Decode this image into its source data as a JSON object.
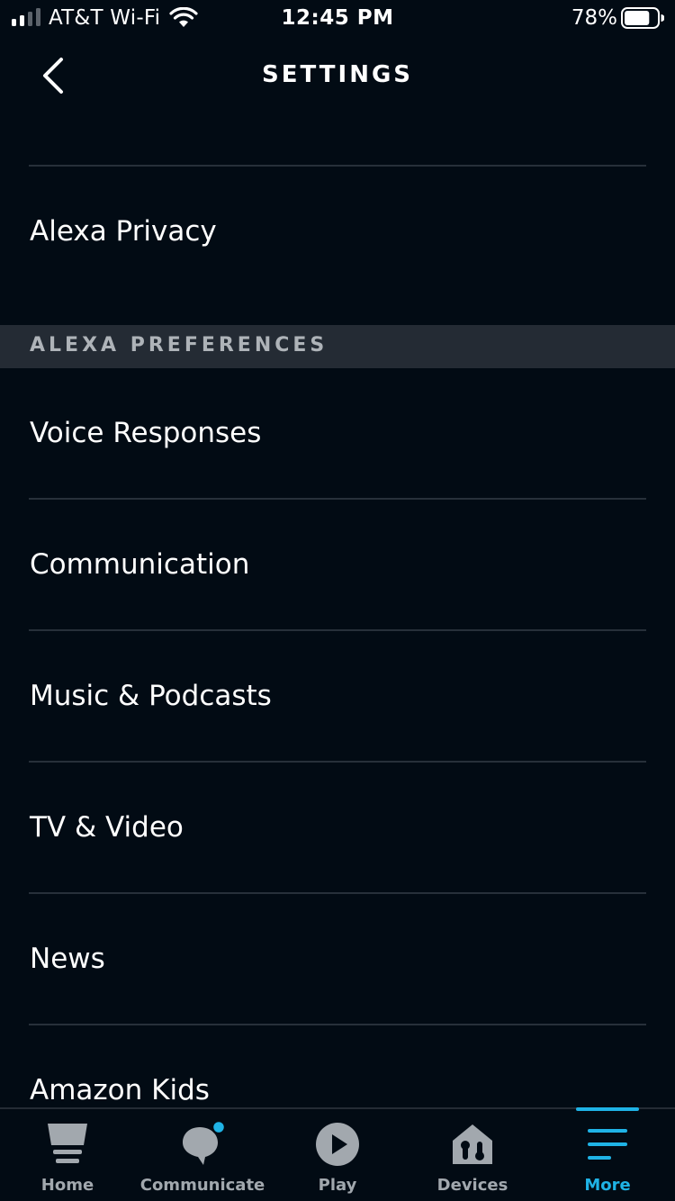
{
  "status_bar": {
    "carrier": "AT&T Wi-Fi",
    "time": "12:45 PM",
    "battery": "78%",
    "battery_level": 0.78
  },
  "header": {
    "title": "SETTINGS",
    "back_icon": "chevron-left-icon"
  },
  "list": {
    "alexa_privacy": "Alexa Privacy",
    "section_header": "ALEXA PREFERENCES",
    "items": [
      {
        "label": "Voice Responses"
      },
      {
        "label": "Communication"
      },
      {
        "label": "Music & Podcasts"
      },
      {
        "label": "TV & Video"
      },
      {
        "label": "News"
      },
      {
        "label": "Amazon Kids"
      }
    ]
  },
  "tab_bar": {
    "active": "More",
    "accent_color": "#1fb3e6",
    "notification_dot_color": "#1fb3e6",
    "tabs": [
      {
        "label": "Home",
        "icon": "home-icon"
      },
      {
        "label": "Communicate",
        "icon": "chat-bubble-icon"
      },
      {
        "label": "Play",
        "icon": "play-icon"
      },
      {
        "label": "Devices",
        "icon": "devices-house-icon"
      },
      {
        "label": "More",
        "icon": "hamburger-menu-icon"
      }
    ]
  }
}
